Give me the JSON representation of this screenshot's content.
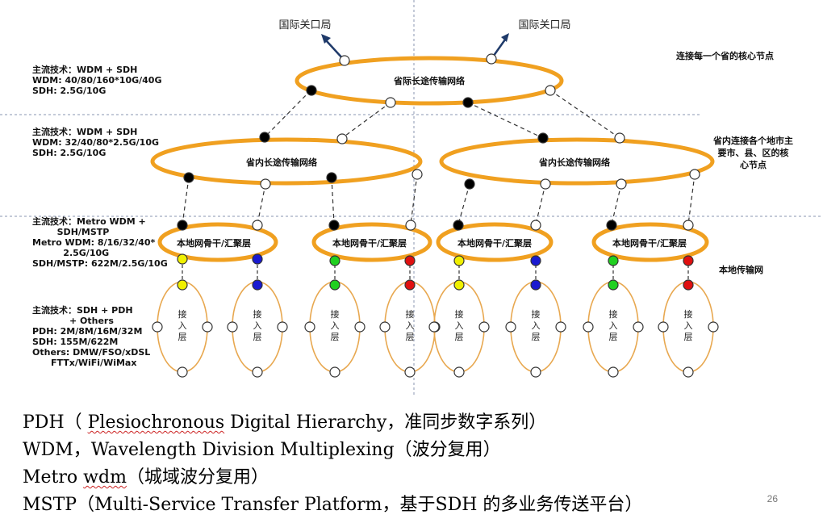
{
  "gateways": [
    "国际关口局",
    "国际关口局"
  ],
  "rings": {
    "backbone": "省际长途传输网络",
    "provincial": [
      "省内长途传输网络",
      "省内长途传输网络"
    ],
    "metro": [
      "本地网骨干/汇聚层",
      "本地网骨干/汇聚层",
      "本地网骨干/汇聚层",
      "本地网骨干/汇聚层"
    ],
    "access": [
      "接\n入\n层",
      "接\n入\n层",
      "接\n入\n层",
      "接\n入\n层",
      "接\n入\n层",
      "接\n入\n层",
      "接\n入\n层",
      "接\n入\n层"
    ]
  },
  "layers": [
    {
      "lines": [
        "主流技术：WDM + SDH",
        "WDM: 40/80/160*10G/40G",
        "SDH: 2.5G/10G"
      ]
    },
    {
      "lines": [
        "主流技术：WDM + SDH",
        "WDM: 32/40/80*2.5G/10G",
        "SDH: 2.5G/10G"
      ]
    },
    {
      "lines": [
        "主流技术：Metro WDM +",
        "        SDH/MSTP",
        "Metro WDM: 8/16/32/40*",
        "          2.5G/10G",
        "SDH/MSTP: 622M/2.5G/10G"
      ]
    },
    {
      "lines": [
        "主流技术：SDH + PDH",
        "            + Others",
        "PDH: 2M/8M/16M/32M",
        "SDH: 155M/622M",
        "Others: DMW/FSO/xDSL",
        "      FTTx/WiFi/WiMax"
      ]
    }
  ],
  "notes": {
    "backbone": "连接每一个省的核心节点",
    "provincial": [
      "省内连接各个地市主",
      "要市、县、区的核",
      "心节点"
    ],
    "local": "本地传输网"
  },
  "footer": {
    "pdh_prefix": "PDH（ ",
    "pdh_term": "Plesiochronous",
    "pdh_rest": " Digital Hierarchy，准同步数字系列）",
    "wdm": "WDM，Wavelength Division Multiplexing（波分复用）",
    "metro_prefix": "Metro ",
    "metro_term": "wdm",
    "metro_rest": "（城域波分复用）",
    "mstp": "MSTP（Multi-Service Transfer Platform，基于SDH 的多业务传送平台）"
  },
  "page_number": "26",
  "colors": {
    "ring_orange": "#F0A020",
    "access_orange": "#E8A850",
    "node_yellow": "#F0F000",
    "node_blue": "#1A1AD0",
    "node_green": "#20D020",
    "node_red": "#E01010",
    "divider": "#8A94B0"
  }
}
